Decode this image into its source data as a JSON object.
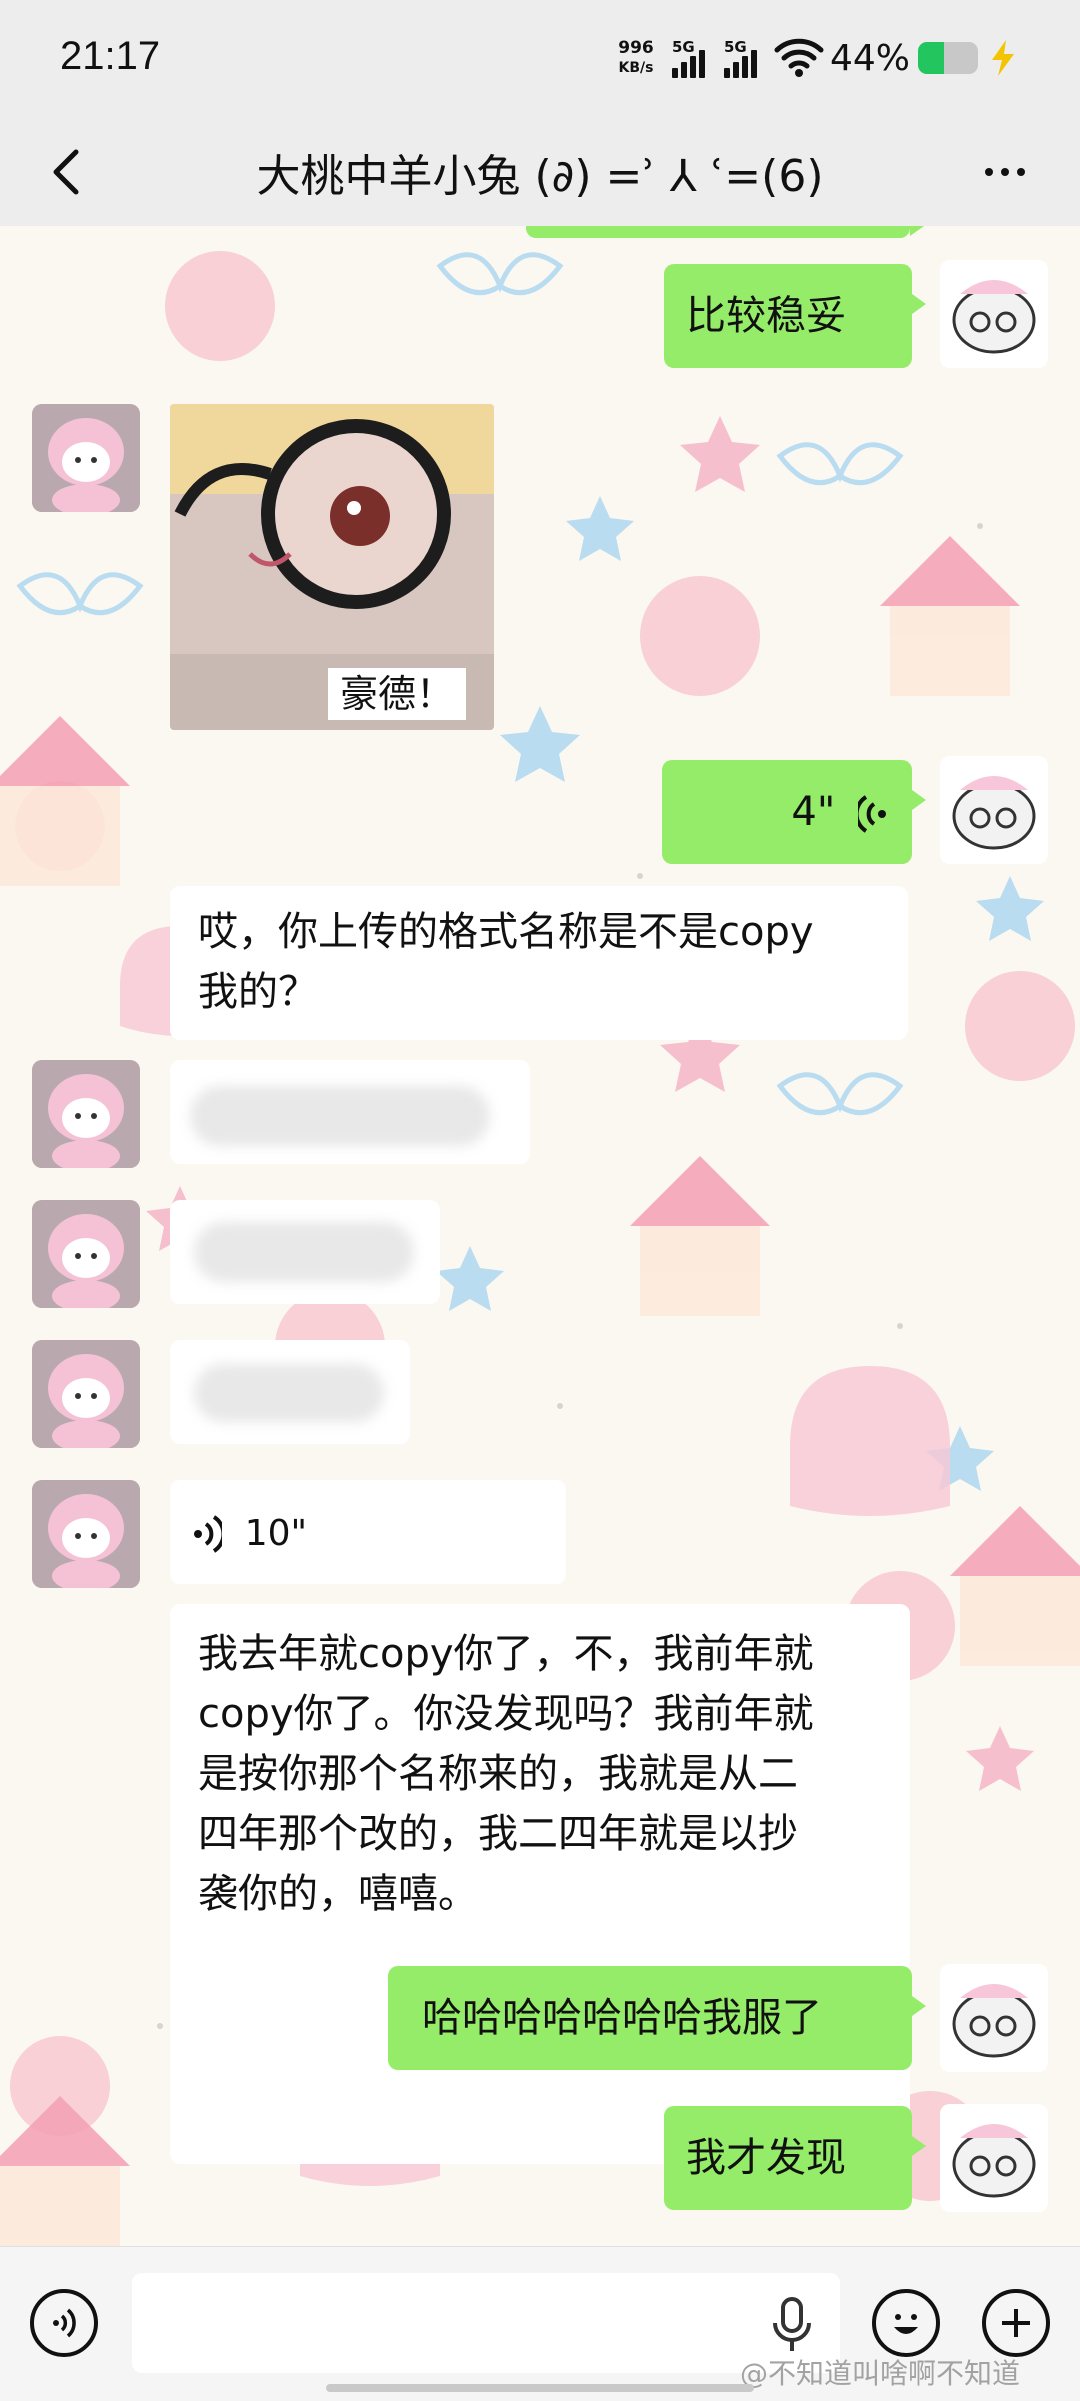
{
  "status_bar": {
    "time": "21:17",
    "net_speed_value": "996",
    "net_speed_unit": "KB/s",
    "signal_1_label": "5G",
    "signal_2_label": "5G",
    "battery_percent": "44%",
    "battery_level": 0.44,
    "battery_color": "#22c55e"
  },
  "header": {
    "title": "大桃中羊小兔 (∂) =ʾ ⅄ ʿ=(6)",
    "back_icon": "chevron-left-icon",
    "more_icon": "more-dots-icon"
  },
  "messages": [
    {
      "side": "right",
      "type": "text",
      "text": "比较稳妥"
    },
    {
      "side": "left",
      "type": "sticker",
      "caption": "豪德！"
    },
    {
      "side": "right",
      "type": "voice",
      "duration": "4\""
    },
    {
      "side": "left",
      "type": "text",
      "text": "哎，你上传的格式名称是不是copy我的？",
      "lines": [
        "哎，你上传的格式名称是不是copy",
        "我的？"
      ]
    },
    {
      "side": "left",
      "type": "redacted"
    },
    {
      "side": "left",
      "type": "redacted"
    },
    {
      "side": "left",
      "type": "redacted"
    },
    {
      "side": "left",
      "type": "voice",
      "duration": "10\""
    },
    {
      "side": "left",
      "type": "text",
      "lines": [
        "我去年就copy你了，不，我前年就",
        "copy你了。你没发现吗？我前年就",
        "是按你那个名称来的，我就是从二",
        "四年那个改的，我二四年就是以抄",
        "袭你的，嘻嘻。"
      ]
    },
    {
      "side": "right",
      "type": "text",
      "text": "哈哈哈哈哈哈哈我服了"
    },
    {
      "side": "right",
      "type": "text",
      "text": "我才发现"
    }
  ],
  "input_bar": {
    "voice_toggle_icon": "voice-mode-icon",
    "mic_icon": "microphone-icon",
    "emoji_icon": "emoji-icon",
    "add_icon": "plus-icon",
    "placeholder": ""
  },
  "watermark": "@不知道叫啥啊不知道",
  "colors": {
    "my_bubble": "#95ec69",
    "other_bubble": "#ffffff",
    "chat_background": "#fbf8f1"
  }
}
